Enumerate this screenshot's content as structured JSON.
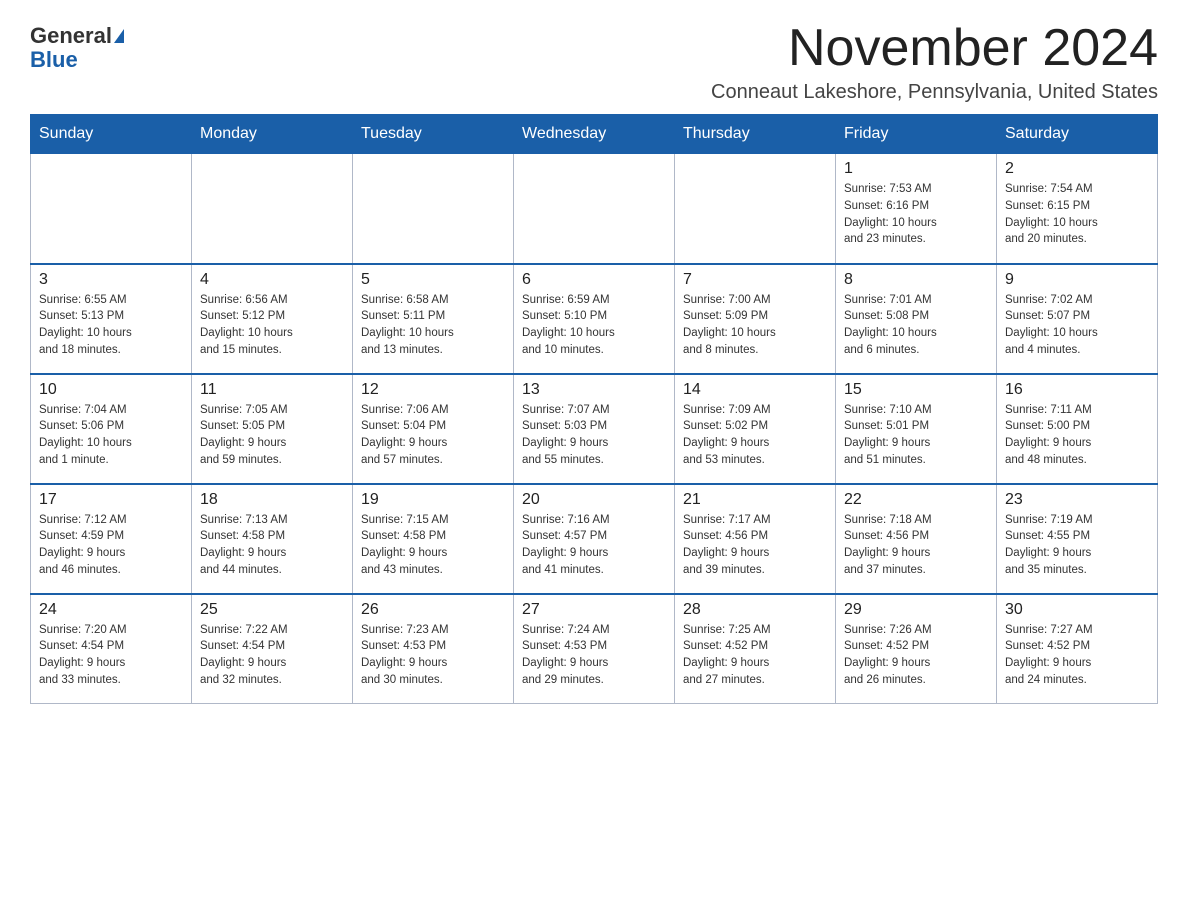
{
  "logo": {
    "name_part1": "General",
    "name_part2": "Blue"
  },
  "title": {
    "month_year": "November 2024",
    "location": "Conneaut Lakeshore, Pennsylvania, United States"
  },
  "days_of_week": [
    "Sunday",
    "Monday",
    "Tuesday",
    "Wednesday",
    "Thursday",
    "Friday",
    "Saturday"
  ],
  "weeks": [
    [
      {
        "day": "",
        "info": ""
      },
      {
        "day": "",
        "info": ""
      },
      {
        "day": "",
        "info": ""
      },
      {
        "day": "",
        "info": ""
      },
      {
        "day": "",
        "info": ""
      },
      {
        "day": "1",
        "info": "Sunrise: 7:53 AM\nSunset: 6:16 PM\nDaylight: 10 hours\nand 23 minutes."
      },
      {
        "day": "2",
        "info": "Sunrise: 7:54 AM\nSunset: 6:15 PM\nDaylight: 10 hours\nand 20 minutes."
      }
    ],
    [
      {
        "day": "3",
        "info": "Sunrise: 6:55 AM\nSunset: 5:13 PM\nDaylight: 10 hours\nand 18 minutes."
      },
      {
        "day": "4",
        "info": "Sunrise: 6:56 AM\nSunset: 5:12 PM\nDaylight: 10 hours\nand 15 minutes."
      },
      {
        "day": "5",
        "info": "Sunrise: 6:58 AM\nSunset: 5:11 PM\nDaylight: 10 hours\nand 13 minutes."
      },
      {
        "day": "6",
        "info": "Sunrise: 6:59 AM\nSunset: 5:10 PM\nDaylight: 10 hours\nand 10 minutes."
      },
      {
        "day": "7",
        "info": "Sunrise: 7:00 AM\nSunset: 5:09 PM\nDaylight: 10 hours\nand 8 minutes."
      },
      {
        "day": "8",
        "info": "Sunrise: 7:01 AM\nSunset: 5:08 PM\nDaylight: 10 hours\nand 6 minutes."
      },
      {
        "day": "9",
        "info": "Sunrise: 7:02 AM\nSunset: 5:07 PM\nDaylight: 10 hours\nand 4 minutes."
      }
    ],
    [
      {
        "day": "10",
        "info": "Sunrise: 7:04 AM\nSunset: 5:06 PM\nDaylight: 10 hours\nand 1 minute."
      },
      {
        "day": "11",
        "info": "Sunrise: 7:05 AM\nSunset: 5:05 PM\nDaylight: 9 hours\nand 59 minutes."
      },
      {
        "day": "12",
        "info": "Sunrise: 7:06 AM\nSunset: 5:04 PM\nDaylight: 9 hours\nand 57 minutes."
      },
      {
        "day": "13",
        "info": "Sunrise: 7:07 AM\nSunset: 5:03 PM\nDaylight: 9 hours\nand 55 minutes."
      },
      {
        "day": "14",
        "info": "Sunrise: 7:09 AM\nSunset: 5:02 PM\nDaylight: 9 hours\nand 53 minutes."
      },
      {
        "day": "15",
        "info": "Sunrise: 7:10 AM\nSunset: 5:01 PM\nDaylight: 9 hours\nand 51 minutes."
      },
      {
        "day": "16",
        "info": "Sunrise: 7:11 AM\nSunset: 5:00 PM\nDaylight: 9 hours\nand 48 minutes."
      }
    ],
    [
      {
        "day": "17",
        "info": "Sunrise: 7:12 AM\nSunset: 4:59 PM\nDaylight: 9 hours\nand 46 minutes."
      },
      {
        "day": "18",
        "info": "Sunrise: 7:13 AM\nSunset: 4:58 PM\nDaylight: 9 hours\nand 44 minutes."
      },
      {
        "day": "19",
        "info": "Sunrise: 7:15 AM\nSunset: 4:58 PM\nDaylight: 9 hours\nand 43 minutes."
      },
      {
        "day": "20",
        "info": "Sunrise: 7:16 AM\nSunset: 4:57 PM\nDaylight: 9 hours\nand 41 minutes."
      },
      {
        "day": "21",
        "info": "Sunrise: 7:17 AM\nSunset: 4:56 PM\nDaylight: 9 hours\nand 39 minutes."
      },
      {
        "day": "22",
        "info": "Sunrise: 7:18 AM\nSunset: 4:56 PM\nDaylight: 9 hours\nand 37 minutes."
      },
      {
        "day": "23",
        "info": "Sunrise: 7:19 AM\nSunset: 4:55 PM\nDaylight: 9 hours\nand 35 minutes."
      }
    ],
    [
      {
        "day": "24",
        "info": "Sunrise: 7:20 AM\nSunset: 4:54 PM\nDaylight: 9 hours\nand 33 minutes."
      },
      {
        "day": "25",
        "info": "Sunrise: 7:22 AM\nSunset: 4:54 PM\nDaylight: 9 hours\nand 32 minutes."
      },
      {
        "day": "26",
        "info": "Sunrise: 7:23 AM\nSunset: 4:53 PM\nDaylight: 9 hours\nand 30 minutes."
      },
      {
        "day": "27",
        "info": "Sunrise: 7:24 AM\nSunset: 4:53 PM\nDaylight: 9 hours\nand 29 minutes."
      },
      {
        "day": "28",
        "info": "Sunrise: 7:25 AM\nSunset: 4:52 PM\nDaylight: 9 hours\nand 27 minutes."
      },
      {
        "day": "29",
        "info": "Sunrise: 7:26 AM\nSunset: 4:52 PM\nDaylight: 9 hours\nand 26 minutes."
      },
      {
        "day": "30",
        "info": "Sunrise: 7:27 AM\nSunset: 4:52 PM\nDaylight: 9 hours\nand 24 minutes."
      }
    ]
  ]
}
